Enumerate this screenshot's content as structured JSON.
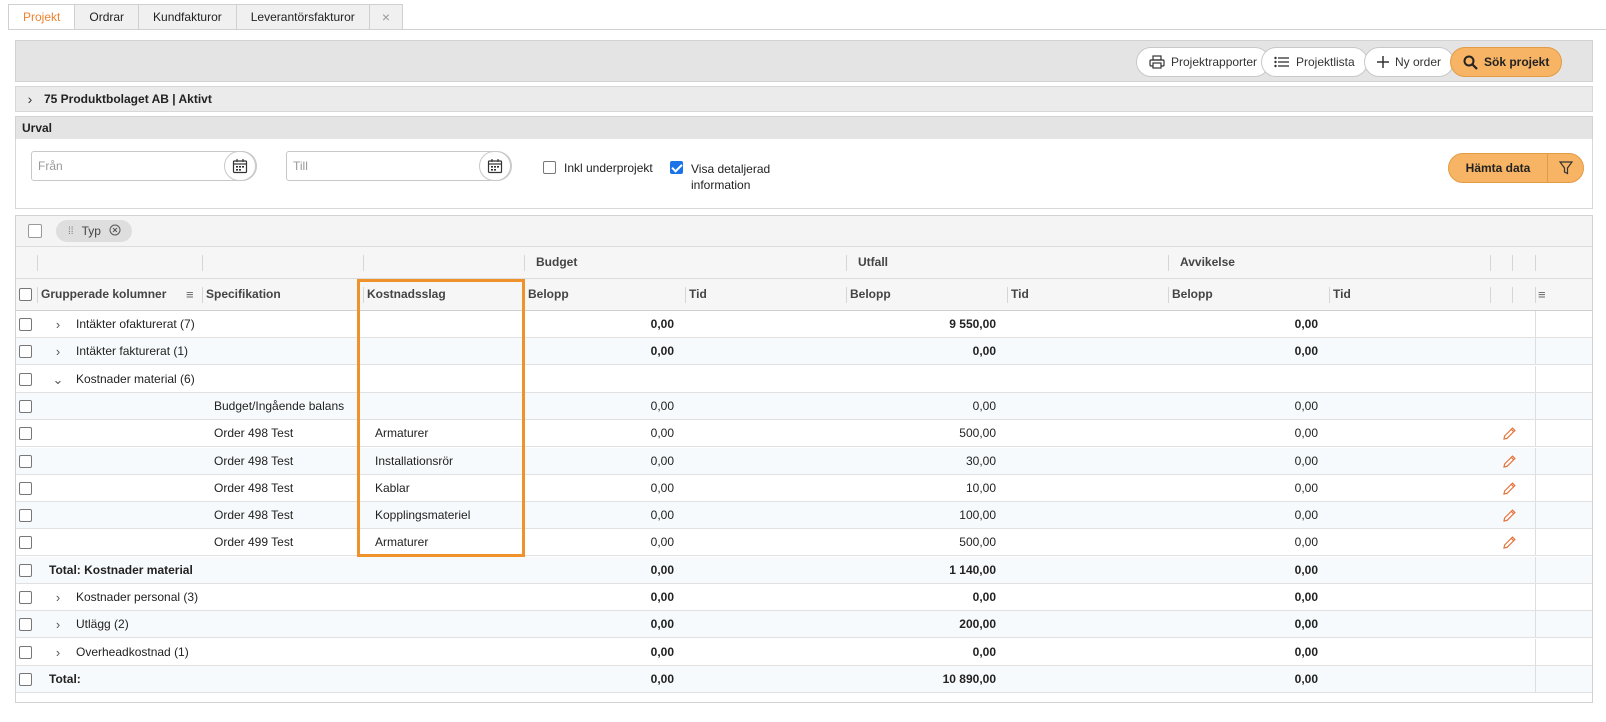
{
  "tabs": [
    {
      "label": "Projekt",
      "active": true
    },
    {
      "label": "Ordrar"
    },
    {
      "label": "Kundfakturor"
    },
    {
      "label": "Leverantörsfakturor"
    }
  ],
  "tab_close_symbol": "×",
  "toolbar": {
    "projektrapporter": "Projektrapporter",
    "projektlista": "Projektlista",
    "ny_order": "Ny order",
    "sok_projekt": "Sök projekt"
  },
  "project": {
    "title": "75 Produktbolaget AB | Aktivt"
  },
  "urval": {
    "title": "Urval",
    "from_placeholder": "Från",
    "to_placeholder": "Till",
    "inkl_underprojekt": "Inkl underprojekt",
    "visa_detaljerad_1": "Visa detaljerad",
    "visa_detaljerad_2": "information",
    "hamta_data": "Hämta data"
  },
  "grid": {
    "group_chip": "Typ",
    "bands": {
      "budget": "Budget",
      "utfall": "Utfall",
      "avvikelse": "Avvikelse"
    },
    "columns": {
      "grupperade": "Grupperade kolumner",
      "specifikation": "Specifikation",
      "kostnadsslag": "Kostnadsslag",
      "belopp": "Belopp",
      "tid": "Tid"
    },
    "rows": [
      {
        "type": "group",
        "expand": "›",
        "label": "Intäkter ofakturerat (7)",
        "spec": "",
        "kost": "",
        "budget": "0,00",
        "utfall": "9 550,00",
        "avv": "0,00",
        "bold": true
      },
      {
        "type": "group",
        "expand": "›",
        "label": "Intäkter fakturerat (1)",
        "spec": "",
        "kost": "",
        "budget": "0,00",
        "utfall": "0,00",
        "avv": "0,00",
        "bold": true
      },
      {
        "type": "group",
        "expand": "⌄",
        "label": "Kostnader material (6)",
        "spec": "",
        "kost": "",
        "budget": "",
        "utfall": "",
        "avv": "",
        "bold": false
      },
      {
        "type": "item",
        "label": "",
        "spec": "Budget/Ingående balans",
        "kost": "",
        "budget": "0,00",
        "utfall": "0,00",
        "avv": "0,00",
        "edit": false
      },
      {
        "type": "item",
        "label": "",
        "spec": "Order 498 Test",
        "kost": "Armaturer",
        "budget": "0,00",
        "utfall": "500,00",
        "avv": "0,00",
        "edit": true
      },
      {
        "type": "item",
        "label": "",
        "spec": "Order 498 Test",
        "kost": "Installationsrör",
        "budget": "0,00",
        "utfall": "30,00",
        "avv": "0,00",
        "edit": true
      },
      {
        "type": "item",
        "label": "",
        "spec": "Order 498 Test",
        "kost": "Kablar",
        "budget": "0,00",
        "utfall": "10,00",
        "avv": "0,00",
        "edit": true
      },
      {
        "type": "item",
        "label": "",
        "spec": "Order 498 Test",
        "kost": "Kopplingsmateriel",
        "budget": "0,00",
        "utfall": "100,00",
        "avv": "0,00",
        "edit": true
      },
      {
        "type": "item",
        "label": "",
        "spec": "Order 499 Test",
        "kost": "Armaturer",
        "budget": "0,00",
        "utfall": "500,00",
        "avv": "0,00",
        "edit": true
      },
      {
        "type": "total",
        "label": "Total: Kostnader material",
        "spec": "",
        "kost": "",
        "budget": "0,00",
        "utfall": "1 140,00",
        "avv": "0,00",
        "bold": true
      },
      {
        "type": "group",
        "expand": "›",
        "label": "Kostnader personal (3)",
        "spec": "",
        "kost": "",
        "budget": "0,00",
        "utfall": "0,00",
        "avv": "0,00",
        "bold": true
      },
      {
        "type": "group",
        "expand": "›",
        "label": "Utlägg (2)",
        "spec": "",
        "kost": "",
        "budget": "0,00",
        "utfall": "200,00",
        "avv": "0,00",
        "bold": true
      },
      {
        "type": "group",
        "expand": "›",
        "label": "Overheadkostnad (1)",
        "spec": "",
        "kost": "",
        "budget": "0,00",
        "utfall": "0,00",
        "avv": "0,00",
        "bold": true
      },
      {
        "type": "total",
        "label": "Total:",
        "spec": "",
        "kost": "",
        "budget": "0,00",
        "utfall": "10 890,00",
        "avv": "0,00",
        "bold": true
      }
    ]
  },
  "colors": {
    "accent": "#f0822c",
    "primary_button": "#f7b464",
    "highlight_border": "#f0922c",
    "checkbox_on": "#1a73e8"
  }
}
